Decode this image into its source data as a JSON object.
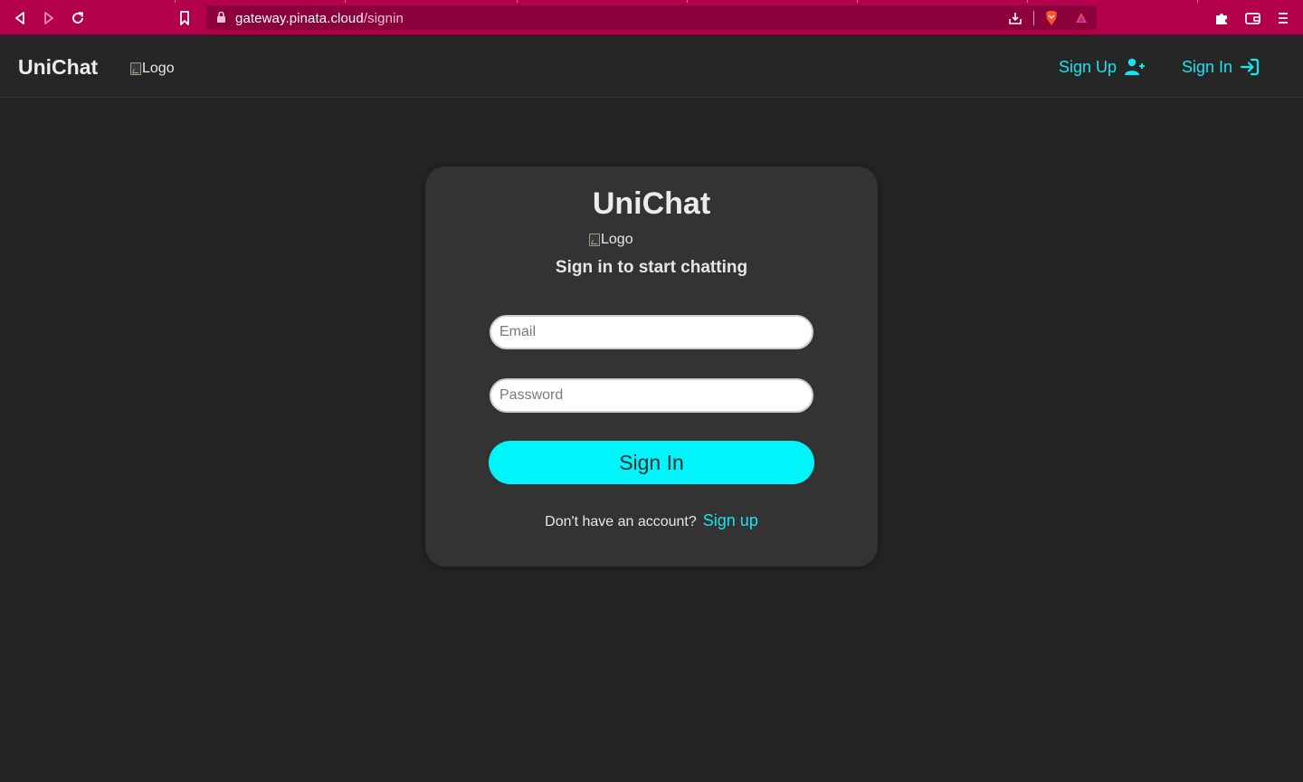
{
  "browser": {
    "url_host": "gateway.pinata.cloud",
    "url_path": "/signin",
    "icons": {
      "back": "back-arrow-icon",
      "forward": "forward-arrow-icon",
      "reload": "reload-icon",
      "bookmark": "bookmark-icon",
      "lock": "lock-icon",
      "download": "download-icon",
      "brave": "brave-shield-icon",
      "rewards": "brave-rewards-icon",
      "extensions": "puzzle-icon",
      "wallet": "wallet-icon",
      "menu": "hamburger-menu-icon"
    }
  },
  "navbar": {
    "brand": "UniChat",
    "logo_alt": "Logo",
    "sign_up_label": "Sign Up",
    "sign_in_label": "Sign In"
  },
  "card": {
    "title": "UniChat",
    "logo_alt": "Logo",
    "subtitle": "Sign in to start chatting",
    "email_placeholder": "Email",
    "password_placeholder": "Password",
    "submit_label": "Sign In",
    "footer_text": "Don't have an account?",
    "footer_link": "Sign up"
  },
  "colors": {
    "accent": "#00f5fb",
    "link": "#14e6f0",
    "browser_bar": "#b3004c",
    "background": "#232425",
    "card": "#333333"
  }
}
